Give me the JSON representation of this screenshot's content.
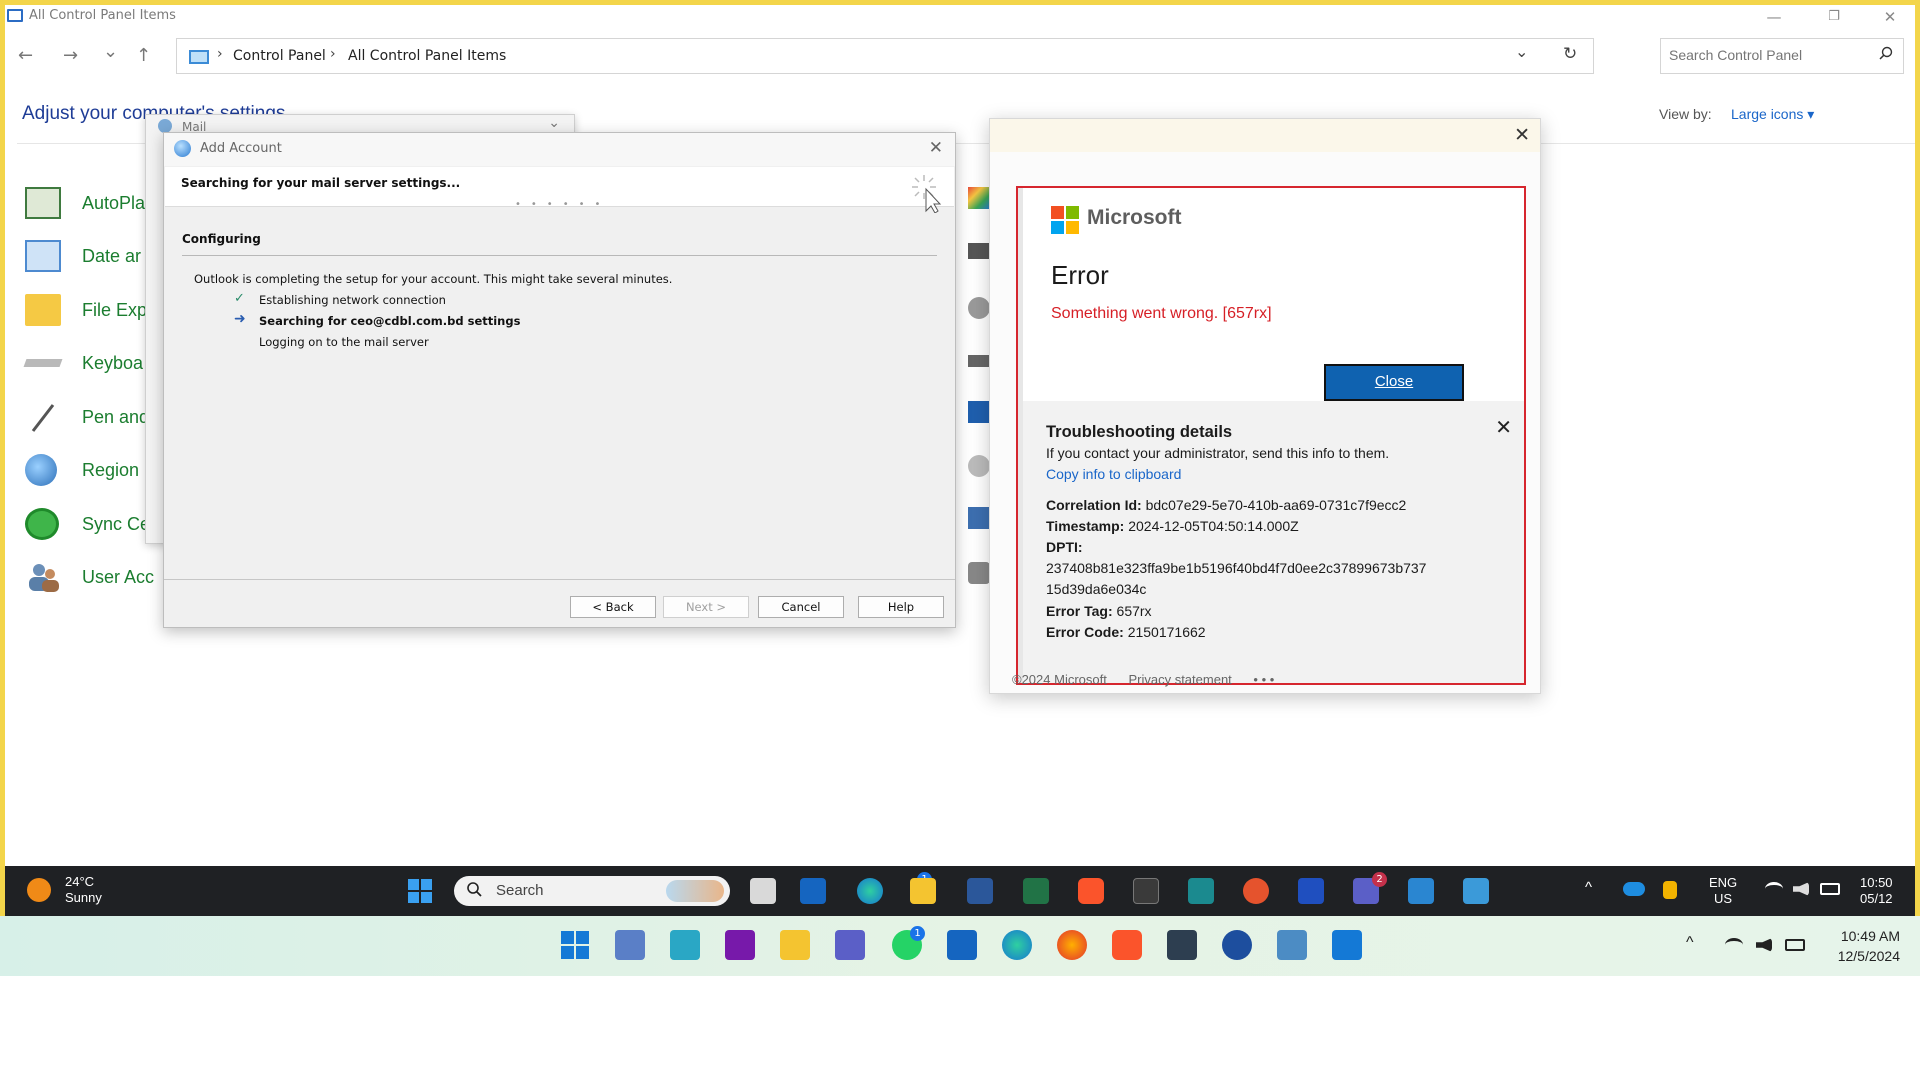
{
  "window": {
    "title": "All Control Panel Items",
    "minimize": "—",
    "restore": "❐",
    "close": "✕"
  },
  "nav": {
    "back": "←",
    "forward": "→",
    "recent": "⌄",
    "up": "↑",
    "breadcrumbs": [
      "Control Panel",
      "All Control Panel Items"
    ],
    "crumb_sep": "›",
    "dropdown": "⌄",
    "refresh": "↻",
    "search_placeholder": "Search Control Panel"
  },
  "page": {
    "heading": "Adjust your computer's settings",
    "view_by_label": "View by:",
    "view_by_value": "Large icons ▾"
  },
  "cp_items": [
    "AutoPla",
    "Date ar",
    "File Exp",
    "Keyboa",
    "Pen and",
    "Region",
    "Sync Ce",
    "User Acc"
  ],
  "mail_window": {
    "title": "Mail",
    "chevron": "⌄"
  },
  "add_account": {
    "title": "Add Account",
    "close": "✕",
    "banner": "Searching for your mail server settings...",
    "section": "Configuring",
    "description": "Outlook is completing the setup for your account. This might take several minutes.",
    "steps": [
      {
        "mark": "✓",
        "text": "Establishing network connection",
        "bold": false
      },
      {
        "mark": "➜",
        "text": "Searching for ceo@cdbl.com.bd settings",
        "bold": true
      },
      {
        "mark": "",
        "text": "Logging on to the mail server",
        "bold": false
      }
    ],
    "buttons": {
      "back": "< Back",
      "next": "Next >",
      "cancel": "Cancel",
      "help": "Help"
    }
  },
  "error_dialog": {
    "close": "✕",
    "brand": "Microsoft",
    "heading": "Error",
    "message": "Something went wrong. [657rx]",
    "close_button": "Close",
    "troubleshooting": {
      "heading": "Troubleshooting details",
      "close": "✕",
      "intro": "If you contact your administrator, send this info to them.",
      "copy_link": "Copy info to clipboard",
      "correlation_label": "Correlation Id:",
      "correlation_value": "bdc07e29-5e70-410b-aa69-0731c7f9ecc2",
      "timestamp_label": "Timestamp:",
      "timestamp_value": "2024-12-05T04:50:14.000Z",
      "dpti_label": "DPTI:",
      "dpti_line1": "237408b81e323ffa9be1b5196f40bd4f7d0ee2c37899673b737",
      "dpti_line2": "15d39da6e034c",
      "error_tag_label": "Error Tag:",
      "error_tag_value": "657rx",
      "error_code_label": "Error Code:",
      "error_code_value": "2150171662"
    },
    "footer_copyright": "©2024 Microsoft",
    "footer_privacy": "Privacy statement",
    "footer_more": "• • •"
  },
  "taskbar_inner": {
    "temp": "24°C",
    "condition": "Sunny",
    "search": "Search",
    "badge_outlook": "1",
    "badge_teams": "2",
    "lang1": "ENG",
    "lang2": "US",
    "time": "10:50",
    "date": "05/12",
    "chevron": "^"
  },
  "taskbar_outer": {
    "badge_whatsapp": "1",
    "time": "10:49 AM",
    "date": "12/5/2024",
    "chevron": "^"
  },
  "colors": {
    "accent_yellow": "#f3d54a",
    "link_blue": "#1a66c9",
    "cp_green": "#1b7d2f",
    "error_red": "#d61f26",
    "close_button_blue": "#0f62b0"
  }
}
